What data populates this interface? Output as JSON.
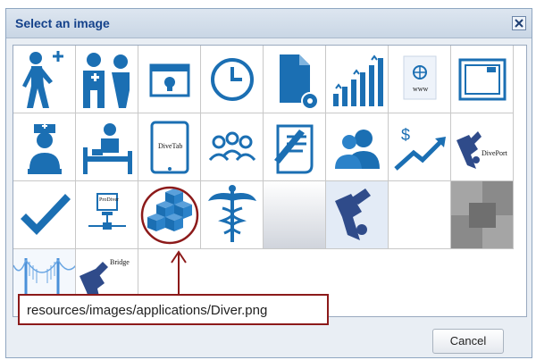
{
  "dialog": {
    "title": "Select an image",
    "close_icon": "close-x-icon",
    "tooltip_path": "resources/images/applications/Diver.png",
    "cancel_label": "Cancel"
  },
  "tiles": [
    {
      "icon": "hiker-plus-icon"
    },
    {
      "icon": "doctor-patient-icon"
    },
    {
      "icon": "browser-bulb-icon"
    },
    {
      "icon": "clock-icon"
    },
    {
      "icon": "document-gear-icon"
    },
    {
      "icon": "growth-chart-icon"
    },
    {
      "icon": "globe-www-icon",
      "text": "www"
    },
    {
      "icon": "window-frame-icon"
    },
    {
      "icon": "nurse-icon"
    },
    {
      "icon": "hospital-bed-icon"
    },
    {
      "icon": "tablet-icon",
      "text": "DiveTab"
    },
    {
      "icon": "people-group-icon"
    },
    {
      "icon": "pen-scroll-icon"
    },
    {
      "icon": "users-icon"
    },
    {
      "icon": "dollar-trend-icon"
    },
    {
      "icon": "diver-icon",
      "text": "DivePort"
    },
    {
      "icon": "checkmark-icon"
    },
    {
      "icon": "prodiver-network-icon",
      "text": "ProDiver"
    },
    {
      "icon": "cubes-icon",
      "selected": true
    },
    {
      "icon": "caduceus-icon"
    },
    {
      "icon": "gray-gradient-image"
    },
    {
      "icon": "diver-figure-icon"
    },
    {
      "icon": "blank-image"
    },
    {
      "icon": "checker-gray-image"
    },
    {
      "icon": "bridge-image"
    },
    {
      "icon": "bridge-diver-icon",
      "text": "Bridge"
    }
  ],
  "colors": {
    "icon_blue": "#1b6fb3",
    "title_text": "#15428b",
    "annotation_red": "#8c1a1a"
  }
}
